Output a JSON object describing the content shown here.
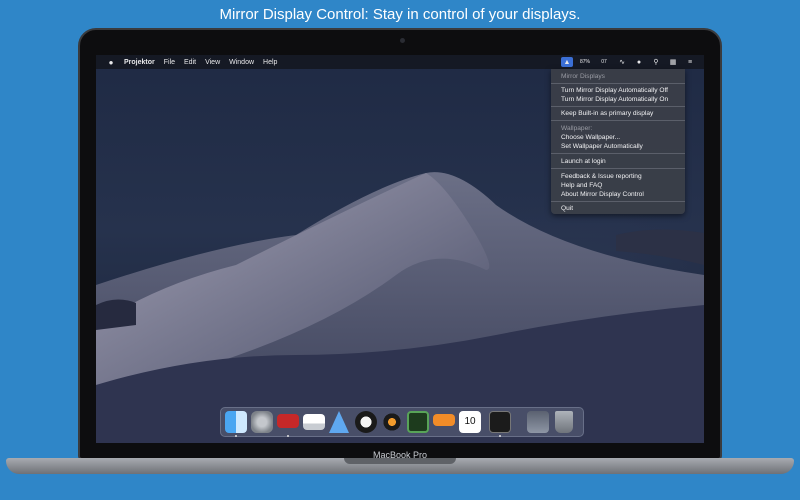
{
  "headline": "Mirror Display Control: Stay in control of your displays.",
  "laptop_label": "MacBook Pro",
  "menubar": {
    "app_name": "Projektor",
    "menus": [
      "File",
      "Edit",
      "View",
      "Window",
      "Help"
    ],
    "status_icons": [
      "mirror-display-icon",
      "battery-icon",
      "temperature-icon",
      "wifi-icon",
      "user-icon",
      "search-icon",
      "calendar-icon",
      "notification-list-icon"
    ],
    "battery_text": "87%",
    "temp_text": "07"
  },
  "dropdown": {
    "header_mirror": "Mirror Displays",
    "turn_off": "Turn Mirror Display Automatically Off",
    "turn_on": "Turn Mirror Display Automatically On",
    "keep_builtin": "Keep Built-in as primary display",
    "header_wallpaper": "Wallpaper:",
    "choose_wallpaper": "Choose Wallpaper...",
    "set_wallpaper": "Set Wallpaper Automatically",
    "launch_login": "Launch at login",
    "feedback": "Feedback & Issue reporting",
    "help_faq": "Help and FAQ",
    "about": "About Mirror Display Control",
    "quit": "Quit"
  },
  "dock": {
    "apps": [
      "finder-icon",
      "system-preferences-icon",
      "photo-booth-icon",
      "display-arrangement-icon",
      "mirror-display-control-icon",
      "coffee-icon",
      "disk-utility-icon",
      "activity-monitor-icon",
      "pages-icon",
      "calendar-icon",
      "terminal-icon",
      "downloads-stack-icon",
      "trash-icon"
    ],
    "calendar_day": "10"
  },
  "colors": {
    "background": "#2f86c8",
    "accent_highlight": "#3b6fd6"
  }
}
